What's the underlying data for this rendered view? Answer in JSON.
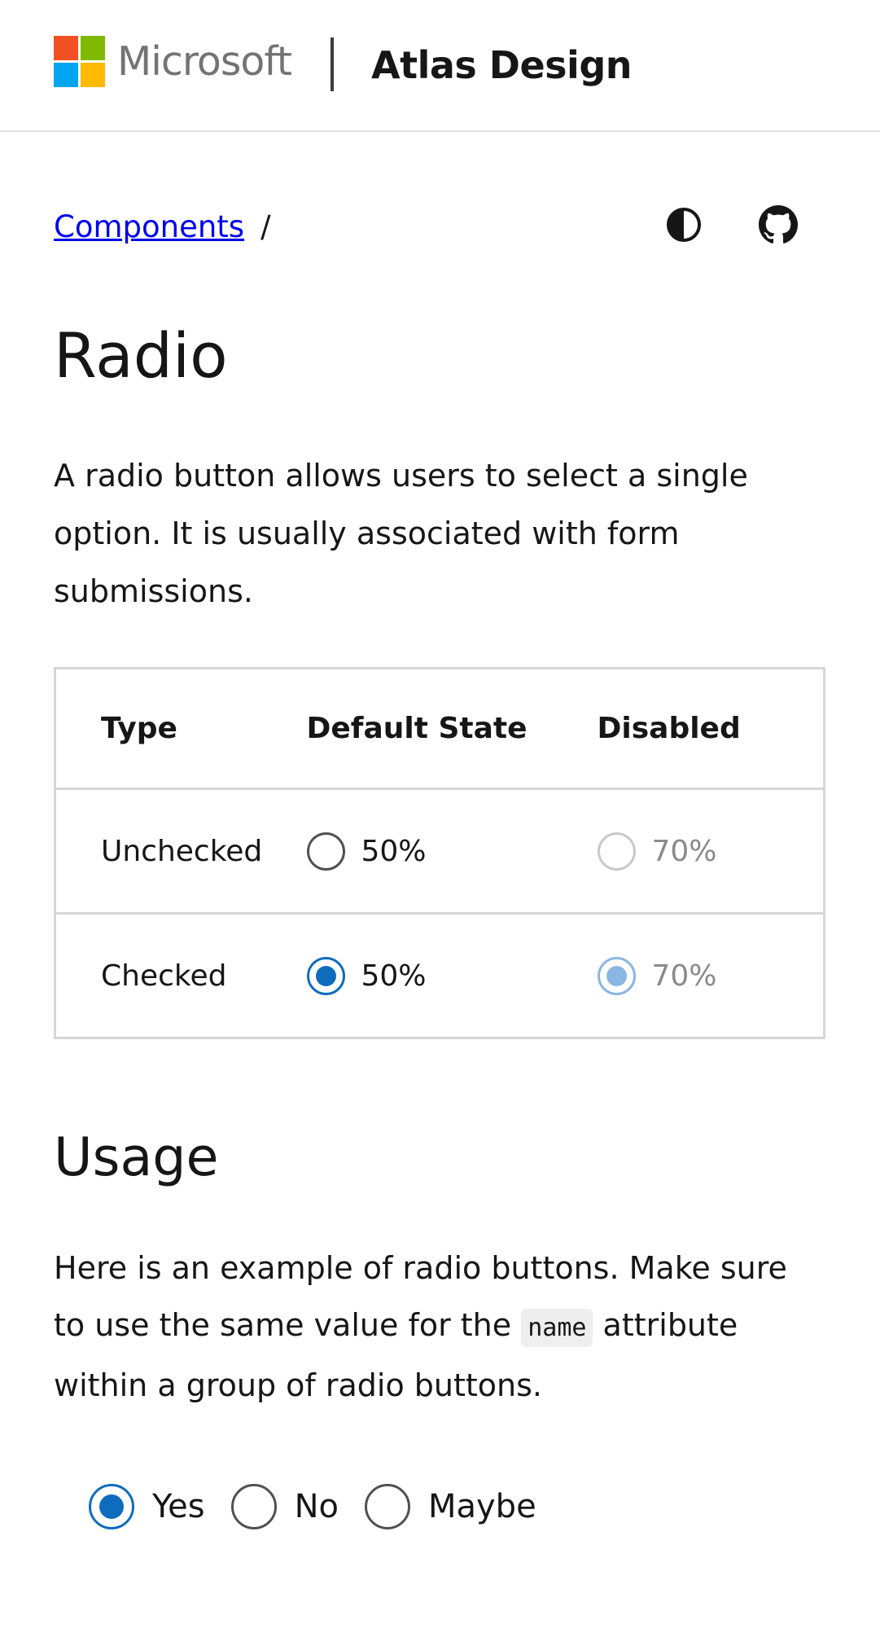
{
  "header": {
    "brand": "Microsoft",
    "product": "Atlas Design",
    "logo_colors": [
      "#f25022",
      "#7fba00",
      "#00a4ef",
      "#ffb900"
    ]
  },
  "breadcrumb": {
    "link": "Components",
    "separator": "/"
  },
  "utility": {
    "theme_icon": "contrast-icon",
    "github_icon": "github-icon"
  },
  "page": {
    "title": "Radio",
    "intro": "A radio button allows users to select a single option. It is usually associated with form submissions."
  },
  "table": {
    "headers": [
      "Type",
      "Default State",
      "Disabled"
    ],
    "rows": [
      {
        "type": "Unchecked",
        "default_label": "50%",
        "disabled_label": "70%",
        "checked": false
      },
      {
        "type": "Checked",
        "default_label": "50%",
        "disabled_label": "70%",
        "checked": true
      }
    ]
  },
  "usage": {
    "title": "Usage",
    "text_before": "Here is an example of radio buttons. Make sure to use the same value for the ",
    "code": "name",
    "text_after": " attribute within a group of radio buttons.",
    "options": [
      {
        "label": "Yes",
        "checked": true
      },
      {
        "label": "No",
        "checked": false
      },
      {
        "label": "Maybe",
        "checked": false
      }
    ]
  },
  "colors": {
    "accent": "#0f6cbd",
    "accent_disabled": "#8ab6e3",
    "link": "#0000ee"
  }
}
